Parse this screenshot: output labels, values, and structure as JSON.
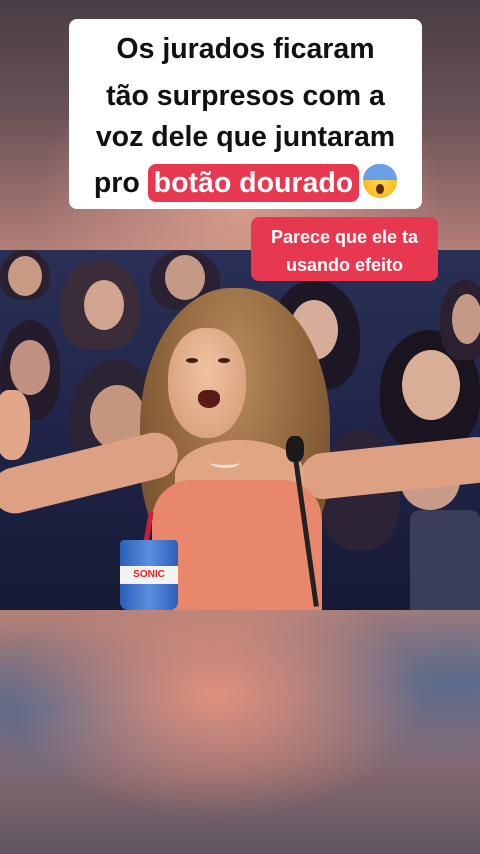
{
  "caption": {
    "line1": "Os jurados ficaram",
    "line2": "tão surpresos com a",
    "line3": "voz dele que juntaram",
    "line4_prefix": "pro",
    "highlight": "botão dourado",
    "emoji": "😱"
  },
  "side_note": {
    "line1": "Parece que ele ta",
    "line2": "usando efeito"
  },
  "video": {
    "cup_label": "SONIC"
  },
  "colors": {
    "highlight": "#e8384f",
    "caption_bg": "#ffffff",
    "caption_text": "#111111"
  }
}
